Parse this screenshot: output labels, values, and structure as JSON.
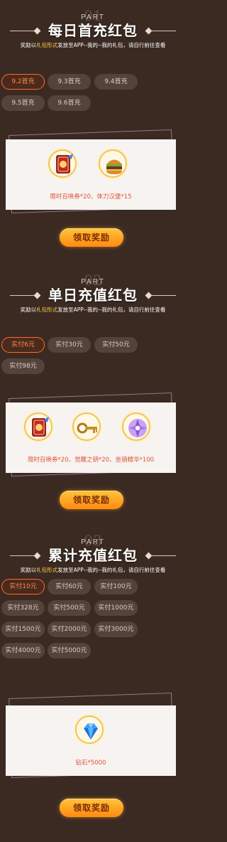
{
  "sections": [
    {
      "part_num": "01",
      "part_label": "PART",
      "title": "每日首充红包",
      "subtitle_a": "奖励以",
      "subtitle_hl": "礼包形式",
      "subtitle_b": "发放至APP--我的--我的礼包，请自行前往查看",
      "tabs": [
        "9.2首充",
        "9.3首充",
        "9.4首充",
        "9.5首充",
        "9.6首充"
      ],
      "active_tab": "9.2首充",
      "reward_text": "限时召唤券*20、体力汉堡*15",
      "claim_label": "领取奖励"
    },
    {
      "part_num": "02",
      "part_label": "PART",
      "title": "单日充值红包",
      "subtitle_a": "奖励以",
      "subtitle_hl": "礼包形式",
      "subtitle_b": "发放至APP--我的--我的礼包，请自行前往查看",
      "tabs": [
        "实付6元",
        "实付30元",
        "实付50元",
        "实付98元"
      ],
      "active_tab": "实付6元",
      "reward_text": "限时召唤券*20、觉醒之钥*20、坐骑精华*100",
      "claim_label": "领取奖励"
    },
    {
      "part_num": "03",
      "part_label": "PART",
      "title": "累计充值红包",
      "subtitle_a": "奖励以",
      "subtitle_hl": "礼包形式",
      "subtitle_b": "发放至APP--我的--我的礼包，请自行前往查看",
      "tabs": [
        "实付10元",
        "实付60元",
        "实付100元",
        "实付328元",
        "实付500元",
        "实付1000元",
        "实付1500元",
        "实付2000元",
        "实付3000元",
        "实付4000元",
        "实付5000元"
      ],
      "active_tab": "实付10元",
      "reward_text": "钻石*5000",
      "claim_label": "领取奖励"
    }
  ],
  "icons": {
    "summon_ticket": "summon-ticket-icon",
    "burger": "stamina-burger-icon",
    "key": "awakening-key-icon",
    "crystal": "mount-essence-icon",
    "diamond": "diamond-icon"
  },
  "colors": {
    "background": "#3b2a22",
    "tab": "#54433a",
    "active_border": "#ff6a2b",
    "highlight": "#ffd24a",
    "reward_text": "#e2533a",
    "button": "#ffa622"
  }
}
